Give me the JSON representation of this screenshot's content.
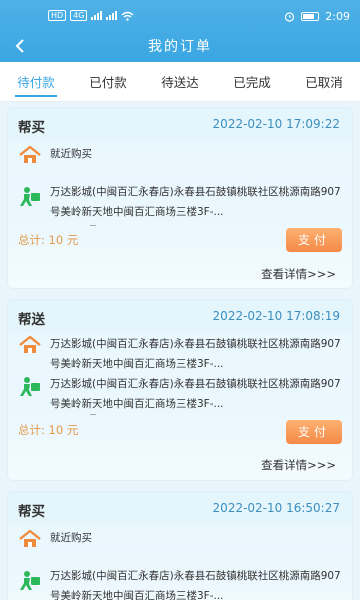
{
  "status_bar": {
    "network_tag1": "HD",
    "network_tag2": "4G",
    "wifi_icon": "wifi-icon",
    "time": "2:09"
  },
  "header": {
    "title": "我的订单",
    "back_icon": "chevron-left-icon"
  },
  "tabs": [
    {
      "label": "待付款",
      "active": true
    },
    {
      "label": "已付款",
      "active": false
    },
    {
      "label": "待送达",
      "active": false
    },
    {
      "label": "已完成",
      "active": false
    },
    {
      "label": "已取消",
      "active": false
    }
  ],
  "orders": [
    {
      "type": "帮买",
      "time": "2022-02-10 17:09:22",
      "pickup": "就近购买",
      "delivery": "万达影城(中闽百汇永春店)永春县石鼓镇桃联社区桃源南路907号美岭新天地中闽百汇商场三楼3F-...",
      "total_label": "总计:",
      "total_value": "10 元",
      "pay_label": "支付",
      "detail_label": "查看详情>>>"
    },
    {
      "type": "帮送",
      "time": "2022-02-10 17:08:19",
      "pickup": "万达影城(中闽百汇永春店)永春县石鼓镇桃联社区桃源南路907号美岭新天地中闽百汇商场三楼3F-...",
      "delivery": "万达影城(中闽百汇永春店)永春县石鼓镇桃联社区桃源南路907号美岭新天地中闽百汇商场三楼3F-...",
      "total_label": "总计:",
      "total_value": "10 元",
      "pay_label": "支付",
      "detail_label": "查看详情>>>"
    },
    {
      "type": "帮买",
      "time": "2022-02-10 16:50:27",
      "pickup": "就近购买",
      "delivery": "万达影城(中闽百汇永春店)永春县石鼓镇桃联社区桃源南路907号美岭新天地中闽百汇商场三楼3F-..."
    }
  ],
  "colors": {
    "accent": "#3aa6e2",
    "time_text": "#3d8fc0",
    "total_text": "#e39a4a",
    "pay_button": "#f58a47",
    "home_icon": "#f08a3c",
    "courier_icon": "#2db85c"
  }
}
